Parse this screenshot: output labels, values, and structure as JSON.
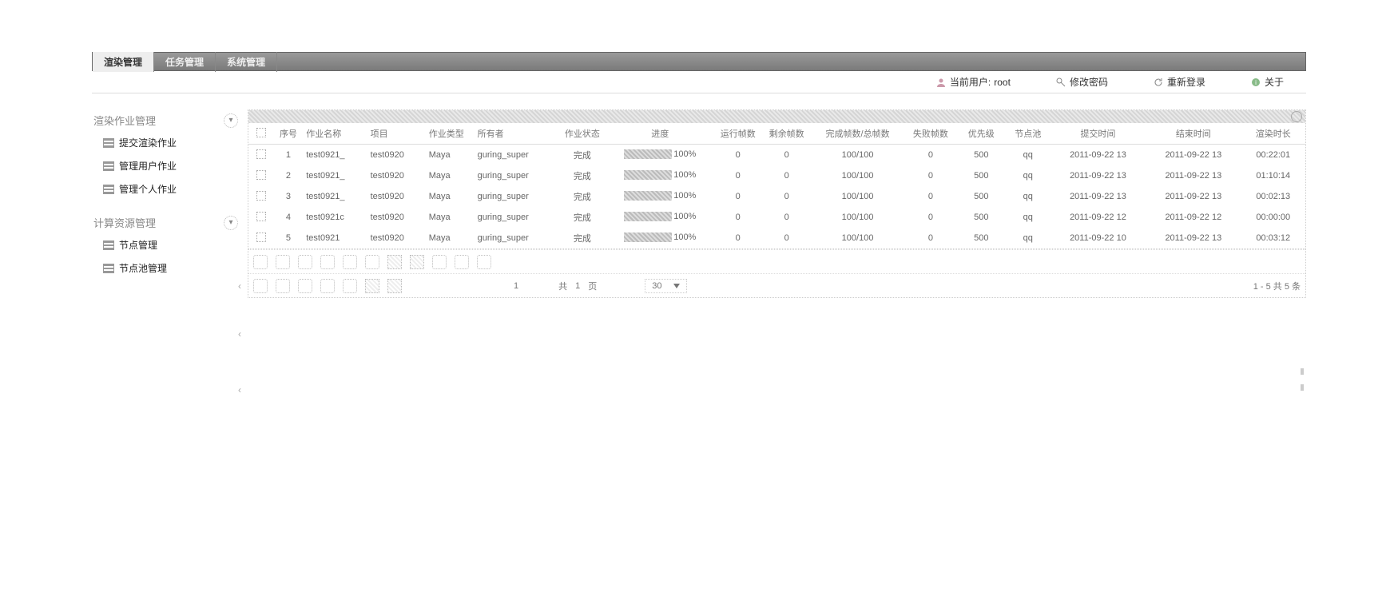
{
  "topNav": {
    "tabs": [
      "渲染管理",
      "任务管理",
      "系统管理"
    ],
    "activeIndex": 0
  },
  "userBar": {
    "currentUserLabel": "当前用户:",
    "currentUserValue": "root",
    "changePasswordLabel": "修改密码",
    "reloginLabel": "重新登录",
    "aboutLabel": "关于"
  },
  "sidebar": {
    "groupA": {
      "title": "渲染作业管理",
      "items": [
        "提交渲染作业",
        "管理用户作业",
        "管理个人作业"
      ]
    },
    "groupB": {
      "title": "计算资源管理",
      "items": [
        "节点管理",
        "节点池管理"
      ]
    }
  },
  "grid": {
    "columns": [
      "",
      "序号",
      "作业名称",
      "项目",
      "作业类型",
      "所有者",
      "作业状态",
      "进度",
      "运行帧数",
      "剩余帧数",
      "完成帧数/总帧数",
      "失败帧数",
      "优先级",
      "节点池",
      "提交时间",
      "结束时间",
      "渲染时长"
    ],
    "rows": [
      {
        "idx": "1",
        "name": "test0921_",
        "proj": "test0920",
        "type": "Maya",
        "owner": "guring_super",
        "status": "完成",
        "progress": "100%",
        "run": "0",
        "remain": "0",
        "done_total": "100/100",
        "fail": "0",
        "prio": "500",
        "pool": "qq",
        "submit": "2011-09-22 13",
        "end": "2011-09-22 13",
        "dur": "00:22:01"
      },
      {
        "idx": "2",
        "name": "test0921_",
        "proj": "test0920",
        "type": "Maya",
        "owner": "guring_super",
        "status": "完成",
        "progress": "100%",
        "run": "0",
        "remain": "0",
        "done_total": "100/100",
        "fail": "0",
        "prio": "500",
        "pool": "qq",
        "submit": "2011-09-22 13",
        "end": "2011-09-22 13",
        "dur": "01:10:14"
      },
      {
        "idx": "3",
        "name": "test0921_",
        "proj": "test0920",
        "type": "Maya",
        "owner": "guring_super",
        "status": "完成",
        "progress": "100%",
        "run": "0",
        "remain": "0",
        "done_total": "100/100",
        "fail": "0",
        "prio": "500",
        "pool": "qq",
        "submit": "2011-09-22 13",
        "end": "2011-09-22 13",
        "dur": "00:02:13"
      },
      {
        "idx": "4",
        "name": "test0921c",
        "proj": "test0920",
        "type": "Maya",
        "owner": "guring_super",
        "status": "完成",
        "progress": "100%",
        "run": "0",
        "remain": "0",
        "done_total": "100/100",
        "fail": "0",
        "prio": "500",
        "pool": "qq",
        "submit": "2011-09-22 12",
        "end": "2011-09-22 12",
        "dur": "00:00:00"
      },
      {
        "idx": "5",
        "name": "test0921",
        "proj": "test0920",
        "type": "Maya",
        "owner": "guring_super",
        "status": "完成",
        "progress": "100%",
        "run": "0",
        "remain": "0",
        "done_total": "100/100",
        "fail": "0",
        "prio": "500",
        "pool": "qq",
        "submit": "2011-09-22 10",
        "end": "2011-09-22 13",
        "dur": "00:03:12"
      }
    ]
  },
  "pager": {
    "pageLabelPrefix": "共",
    "pageLabelValue": "1",
    "pageLabelSuffix": "页",
    "pageSize": "30",
    "summary": "1 - 5   共 5 条"
  }
}
